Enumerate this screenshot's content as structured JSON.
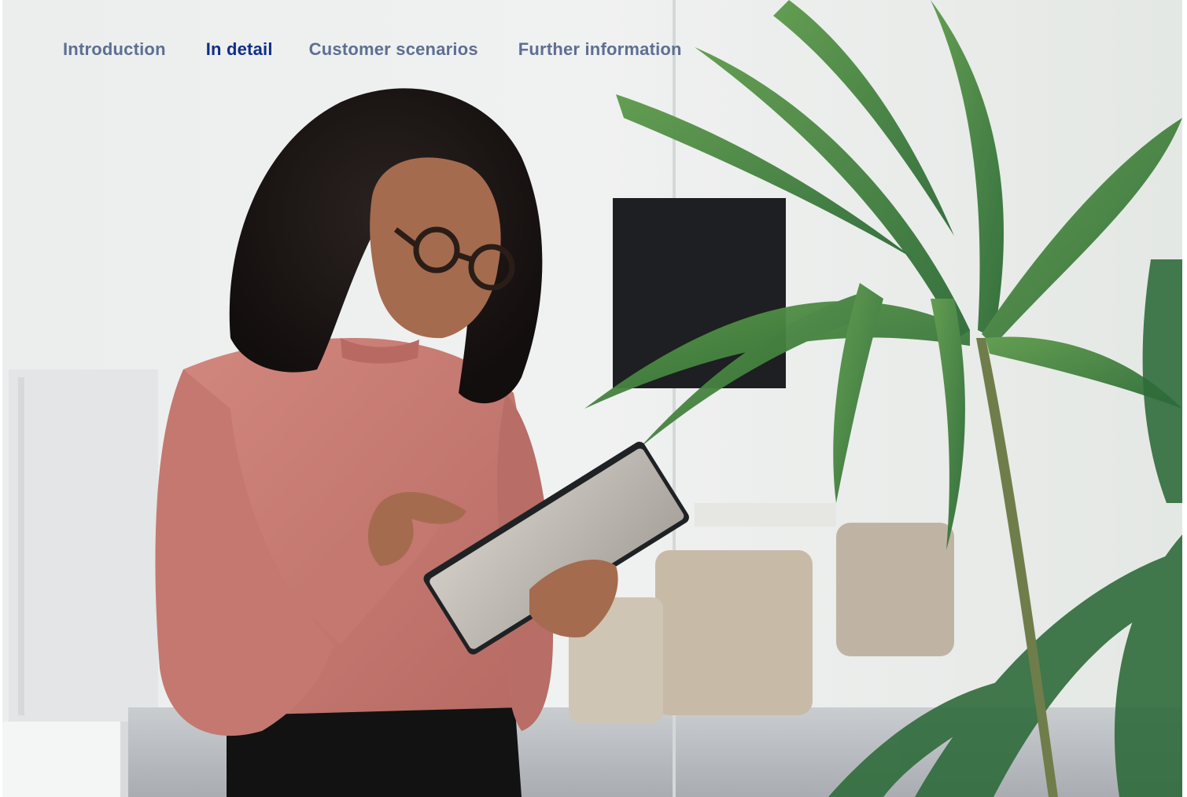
{
  "nav": {
    "tabs": [
      {
        "label": "Introduction",
        "active": false
      },
      {
        "label": "In detail",
        "active": true
      },
      {
        "label": "Customer scenarios",
        "active": false
      },
      {
        "label": "Further information",
        "active": false
      }
    ]
  },
  "colors": {
    "tab_inactive": "#5d6f92",
    "tab_active": "#0f2e8a",
    "blouse": "#c97b73",
    "foliage": "#3f7a3a"
  },
  "hero_image": {
    "subject": "woman-with-tablet-icon"
  }
}
